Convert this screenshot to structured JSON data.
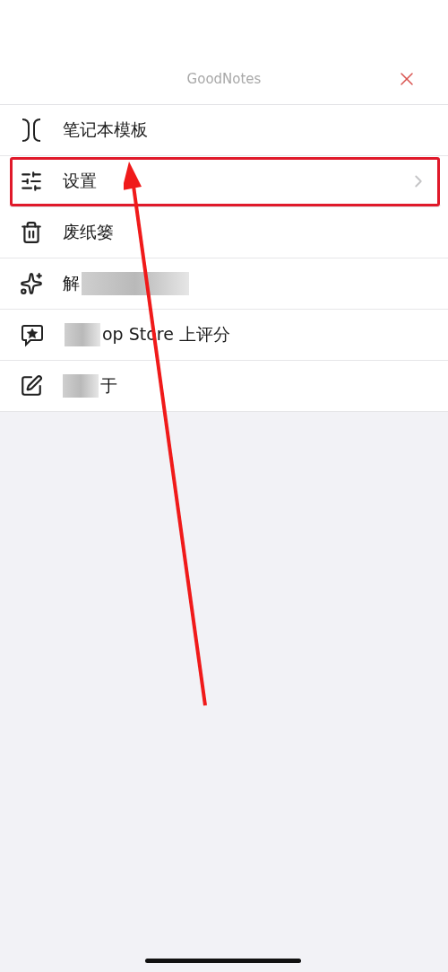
{
  "header": {
    "title": "GoodNotes"
  },
  "menu": [
    {
      "kind": "template",
      "label": "笔记本模板",
      "chevron": false,
      "highlighted": false,
      "redacted": false
    },
    {
      "kind": "settings",
      "label": "设置",
      "chevron": true,
      "highlighted": true,
      "redacted": false
    },
    {
      "kind": "trash",
      "label": "废纸篓",
      "chevron": false,
      "highlighted": false,
      "redacted": false
    },
    {
      "kind": "sparkles",
      "label": "解",
      "chevron": false,
      "highlighted": false,
      "redacted": true
    },
    {
      "kind": "rate",
      "label": "op Store 上评分",
      "chevron": false,
      "highlighted": false,
      "redacted": true
    },
    {
      "kind": "about",
      "label": "于",
      "chevron": false,
      "highlighted": false,
      "redacted": true
    }
  ],
  "annotation_arrow": true
}
